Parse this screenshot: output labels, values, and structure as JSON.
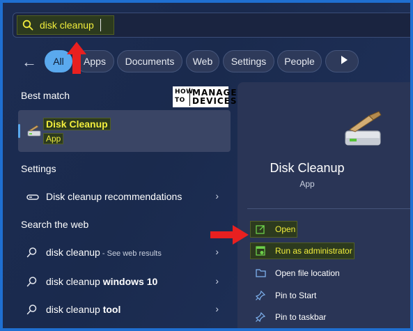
{
  "search": {
    "value": "disk cleanup"
  },
  "filters": {
    "back_icon": "back-arrow-icon",
    "chips": [
      {
        "label": "All",
        "active": true
      },
      {
        "label": "Apps",
        "active": false
      },
      {
        "label": "Documents",
        "active": false
      },
      {
        "label": "Web",
        "active": false
      },
      {
        "label": "Settings",
        "active": false
      },
      {
        "label": "People",
        "active": false
      }
    ]
  },
  "watermark": {
    "line1": "HOW",
    "line2": "TO",
    "line3": "MANAGE",
    "line4": "DEVICES"
  },
  "best_match": {
    "heading": "Best match",
    "title": "Disk Cleanup",
    "subtitle": "App"
  },
  "settings": {
    "heading": "Settings",
    "items": [
      {
        "bold": "Disk cleanup",
        "rest": " recommendations"
      }
    ]
  },
  "web": {
    "heading": "Search the web",
    "items": [
      {
        "normal": "disk cleanup",
        "small": " - See web results"
      },
      {
        "normal": "disk cleanup ",
        "bold": "windows 10"
      },
      {
        "normal": "disk cleanup ",
        "bold": "tool"
      }
    ]
  },
  "preview": {
    "title": "Disk Cleanup",
    "type": "App",
    "actions": [
      {
        "label": "Open",
        "icon": "open-external-icon"
      },
      {
        "label": "Run as administrator",
        "icon": "admin-shield-icon"
      },
      {
        "label": "Open file location",
        "icon": "folder-icon"
      },
      {
        "label": "Pin to Start",
        "icon": "pin-icon"
      },
      {
        "label": "Pin to taskbar",
        "icon": "pin-icon"
      }
    ]
  },
  "colors": {
    "accent": "#5aa9ee",
    "highlight_text": "#f2ee3c",
    "annotation": "#e82020"
  }
}
